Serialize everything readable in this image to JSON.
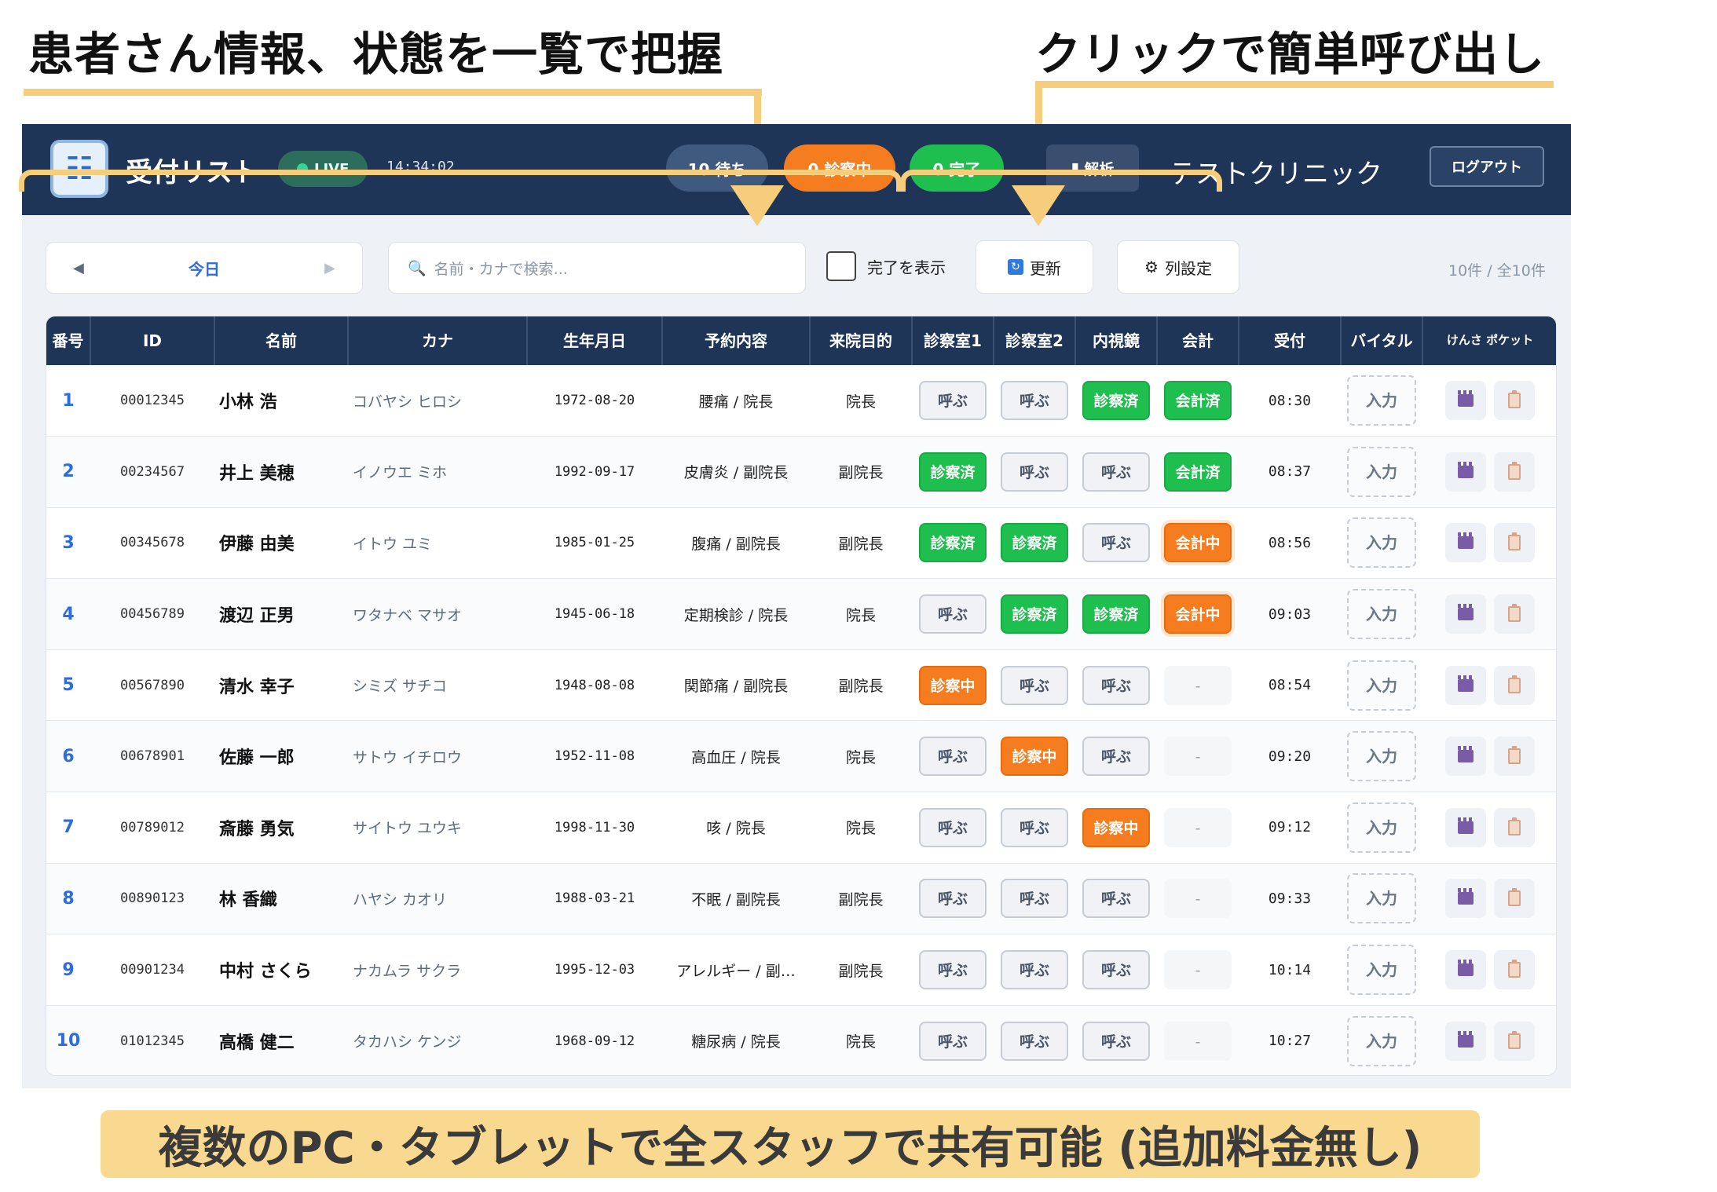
{
  "callouts": {
    "left": "患者さん情報、状態を一覧で把握",
    "right": "クリックで簡単呼び出し",
    "bottom": "複数のPC・タブレットで全スタッフで共有可能 (追加料金無し)"
  },
  "header": {
    "title": "受付リスト",
    "live_label": "LIVE",
    "clock": "14:34:02",
    "wait_pill": "10 待ち",
    "exam_pill": "0 診察中",
    "done_pill": "0 完了",
    "analysis_label": "解析",
    "clinic_name": "テストクリニック",
    "logout_label": "ログアウト"
  },
  "toolbar": {
    "prev_icon": "◀",
    "next_icon": "▶",
    "date_label": "今日",
    "search_placeholder": "名前・カナで検索...",
    "show_done_label": "完了を表示",
    "refresh_label": "更新",
    "columns_label": "列設定",
    "count_text": "10件 / 全10件"
  },
  "table": {
    "headers": [
      "番号",
      "ID",
      "名前",
      "カナ",
      "生年月日",
      "予約内容",
      "来院目的",
      "診察室1",
      "診察室2",
      "内視鏡",
      "会計",
      "受付",
      "バイタル",
      "けんさ ポケット"
    ],
    "vital_label": "入力",
    "rows": [
      {
        "no": "1",
        "id": "00012345",
        "name": "小林 浩",
        "kana": "コバヤシ ヒロシ",
        "dob": "1972-08-20",
        "reservation": "腰痛 / 院長",
        "purpose": "院長",
        "room1": "呼ぶ",
        "room2": "呼ぶ",
        "endo": "診察済",
        "pay": "会計済",
        "time": "08:30"
      },
      {
        "no": "2",
        "id": "00234567",
        "name": "井上 美穂",
        "kana": "イノウエ ミホ",
        "dob": "1992-09-17",
        "reservation": "皮膚炎 / 副院長",
        "purpose": "副院長",
        "room1": "診察済",
        "room2": "呼ぶ",
        "endo": "呼ぶ",
        "pay": "会計済",
        "time": "08:37"
      },
      {
        "no": "3",
        "id": "00345678",
        "name": "伊藤 由美",
        "kana": "イトウ ユミ",
        "dob": "1985-01-25",
        "reservation": "腹痛 / 副院長",
        "purpose": "副院長",
        "room1": "診察済",
        "room2": "診察済",
        "endo": "呼ぶ",
        "pay": "会計中",
        "time": "08:56"
      },
      {
        "no": "4",
        "id": "00456789",
        "name": "渡辺 正男",
        "kana": "ワタナベ マサオ",
        "dob": "1945-06-18",
        "reservation": "定期検診 / 院長",
        "purpose": "院長",
        "room1": "呼ぶ",
        "room2": "診察済",
        "endo": "診察済",
        "pay": "会計中",
        "time": "09:03"
      },
      {
        "no": "5",
        "id": "00567890",
        "name": "清水 幸子",
        "kana": "シミズ サチコ",
        "dob": "1948-08-08",
        "reservation": "関節痛 / 副院長",
        "purpose": "副院長",
        "room1": "診察中",
        "room2": "呼ぶ",
        "endo": "呼ぶ",
        "pay": "-",
        "time": "08:54"
      },
      {
        "no": "6",
        "id": "00678901",
        "name": "佐藤 一郎",
        "kana": "サトウ イチロウ",
        "dob": "1952-11-08",
        "reservation": "高血圧 / 院長",
        "purpose": "院長",
        "room1": "呼ぶ",
        "room2": "診察中",
        "endo": "呼ぶ",
        "pay": "-",
        "time": "09:20"
      },
      {
        "no": "7",
        "id": "00789012",
        "name": "斎藤 勇気",
        "kana": "サイトウ ユウキ",
        "dob": "1998-11-30",
        "reservation": "咳 / 院長",
        "purpose": "院長",
        "room1": "呼ぶ",
        "room2": "呼ぶ",
        "endo": "診察中",
        "pay": "-",
        "time": "09:12"
      },
      {
        "no": "8",
        "id": "00890123",
        "name": "林 香織",
        "kana": "ハヤシ カオリ",
        "dob": "1988-03-21",
        "reservation": "不眠 / 副院長",
        "purpose": "副院長",
        "room1": "呼ぶ",
        "room2": "呼ぶ",
        "endo": "呼ぶ",
        "pay": "-",
        "time": "09:33"
      },
      {
        "no": "9",
        "id": "00901234",
        "name": "中村 さくら",
        "kana": "ナカムラ サクラ",
        "dob": "1995-12-03",
        "reservation": "アレルギー / 副…",
        "purpose": "副院長",
        "room1": "呼ぶ",
        "room2": "呼ぶ",
        "endo": "呼ぶ",
        "pay": "-",
        "time": "10:14"
      },
      {
        "no": "10",
        "id": "01012345",
        "name": "高橋 健二",
        "kana": "タカハシ ケンジ",
        "dob": "1968-09-12",
        "reservation": "糖尿病 / 院長",
        "purpose": "院長",
        "room1": "呼ぶ",
        "room2": "呼ぶ",
        "endo": "呼ぶ",
        "pay": "-",
        "time": "10:27"
      }
    ]
  },
  "colors": {
    "header_bg": "#1e3557",
    "done_green": "#1fbf4f",
    "active_orange": "#f57c1f",
    "callout_yellow": "#f6cd7b",
    "banner_yellow": "#f8d98f"
  }
}
